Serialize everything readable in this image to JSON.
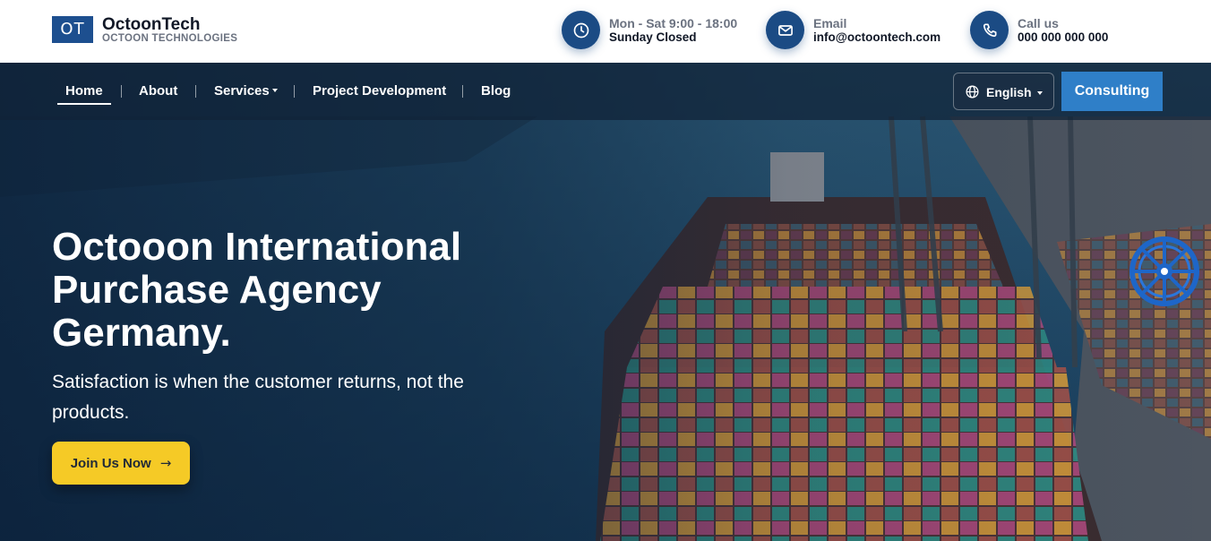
{
  "brand": {
    "logo_text": "OT",
    "name": "OctoonTech",
    "subtitle": "OCTOON TECHNOLOGIES"
  },
  "contact": [
    {
      "icon": "clock-icon",
      "line1": "Mon - Sat 9:00 - 18:00",
      "line2": "Sunday Closed"
    },
    {
      "icon": "envelope-icon",
      "line1": "Email",
      "line2": "info@octoontech.com"
    },
    {
      "icon": "phone-icon",
      "line1": "Call us",
      "line2": "000 000 000 000"
    }
  ],
  "nav": {
    "items": [
      {
        "label": "Home",
        "active": true
      },
      {
        "label": "About"
      },
      {
        "label": "Services",
        "dropdown": true
      },
      {
        "label": "Project Development"
      },
      {
        "label": "Blog"
      }
    ],
    "language": "English",
    "consult_label": "Consulting"
  },
  "hero": {
    "title_lines": [
      "Octooon International",
      "Purchase Agency",
      "Germany."
    ],
    "subtitle": "Satisfaction is when the customer returns, not the products.",
    "cta_label": "Join Us Now",
    "cta_arrow": "→"
  },
  "colors": {
    "brand_blue": "#1d4f8f",
    "icon_circle": "#1b4b84",
    "consult_blue": "#2f7fc8",
    "cta_yellow": "#f5ca26"
  }
}
